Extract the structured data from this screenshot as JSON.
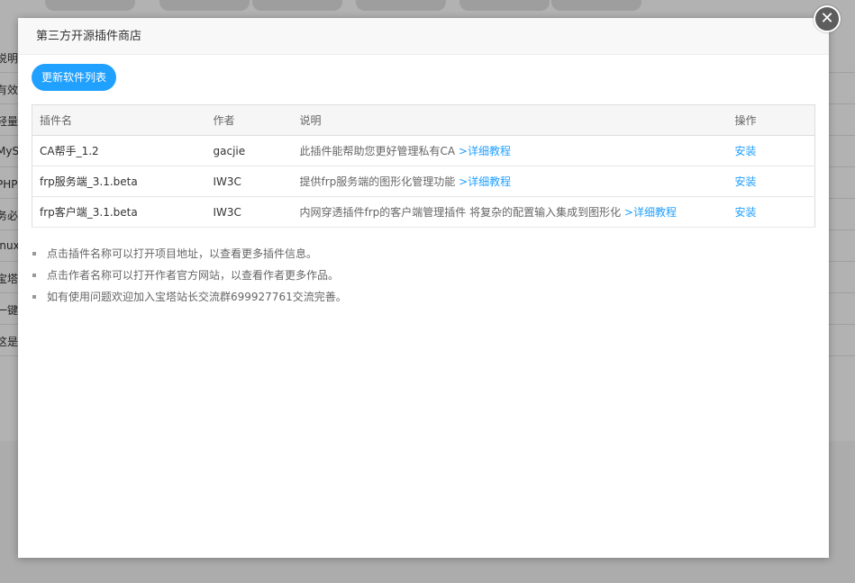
{
  "background": {
    "row_fragments": [
      "说明",
      "有效期",
      "轻量级",
      "MySQ",
      "PHP第",
      "务必",
      "inux",
      "宝塔",
      "一键",
      "这是一"
    ]
  },
  "modal": {
    "title": "第三方开源插件商店",
    "close_icon": "close-icon",
    "update_button": "更新软件列表",
    "table": {
      "headers": [
        "插件名",
        "作者",
        "说明",
        "操作"
      ],
      "rows": [
        {
          "name": "CA帮手_1.2",
          "author": "gacjie",
          "desc": "此插件能帮助您更好管理私有CA",
          "tutorial": ">详细教程",
          "action": "安装"
        },
        {
          "name": "frp服务端_3.1.beta",
          "author": "IW3C",
          "desc": "提供frp服务端的图形化管理功能",
          "tutorial": ">详细教程",
          "action": "安装"
        },
        {
          "name": "frp客户端_3.1.beta",
          "author": "IW3C",
          "desc": "内网穿透插件frp的客户端管理插件 将复杂的配置输入集成到图形化",
          "tutorial": ">详细教程",
          "action": "安装"
        }
      ]
    },
    "notes": [
      "点击插件名称可以打开项目地址，以查看更多插件信息。",
      "点击作者名称可以打开作者官方网站，以查看作者更多作品。",
      "如有使用问题欢迎加入宝塔站长交流群699927761交流完善。"
    ]
  },
  "colors": {
    "accent": "#20a0ff",
    "close_bg": "#5d5d5d"
  }
}
